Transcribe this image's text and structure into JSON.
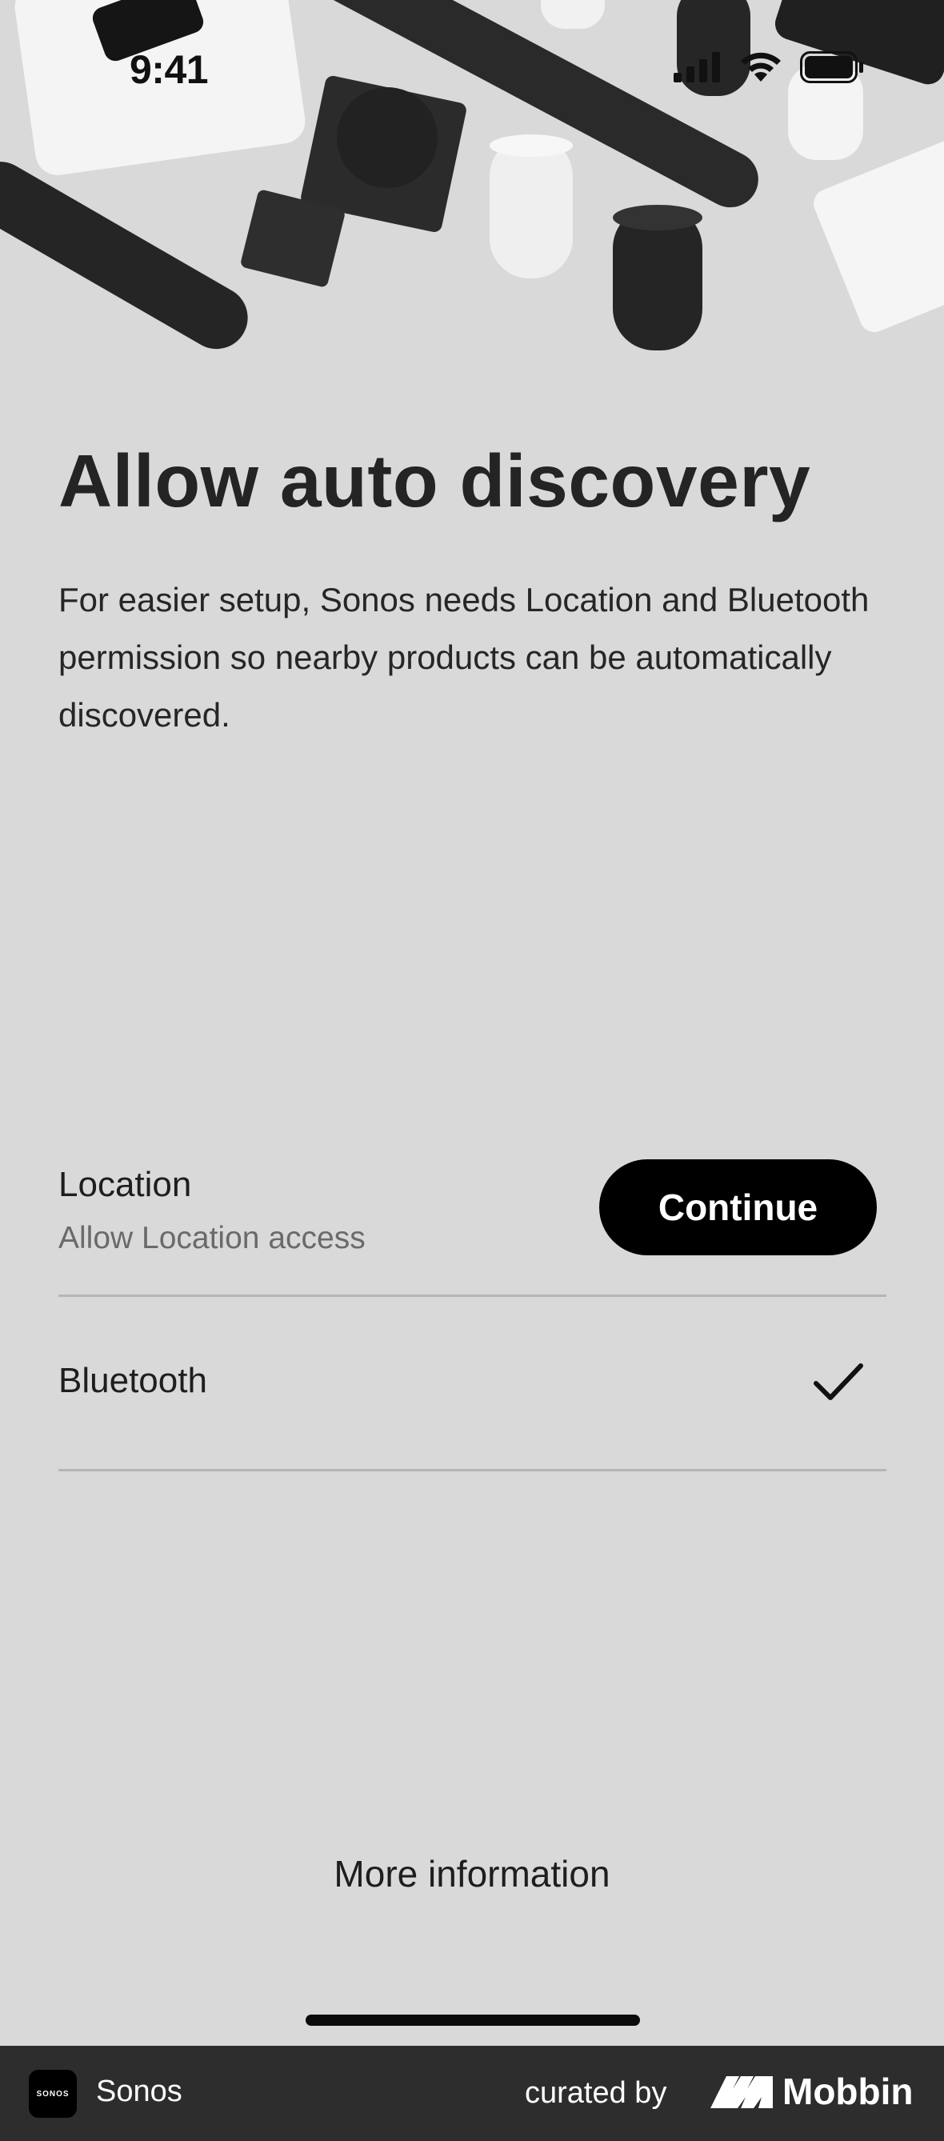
{
  "status_bar": {
    "time": "9:41"
  },
  "hero": {
    "image_description_icon": "speakers-product-photo"
  },
  "main": {
    "title": "Allow auto discovery",
    "description": "For easier setup, Sonos needs Location and Bluetooth permission so nearby products can be automatically discovered."
  },
  "permissions": {
    "location": {
      "label": "Location",
      "sublabel": "Allow Location access",
      "button_label": "Continue"
    },
    "bluetooth": {
      "label": "Bluetooth",
      "status_icon": "checkmark-icon"
    }
  },
  "more_info_label": "More information",
  "footer": {
    "app_logo_text": "SONOS",
    "app_name": "Sonos",
    "curated_by": "curated by",
    "brand": "Mobbin"
  },
  "colors": {
    "background": "#d9d9d9",
    "button": "#000000",
    "footer": "#2d2d2d"
  }
}
